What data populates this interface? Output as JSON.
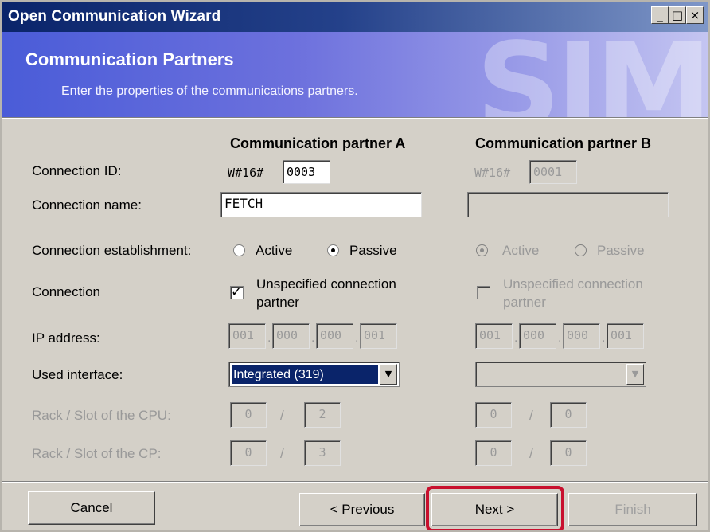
{
  "window": {
    "title": "Open Communication Wizard",
    "controls": {
      "minimize": "_",
      "maximize": "□",
      "close": "×"
    }
  },
  "header": {
    "title": "Communication Partners",
    "subtitle": "Enter the properties of the communications partners.",
    "watermark": "SIM"
  },
  "columns": {
    "a": "Communication partner A",
    "b": "Communication partner B"
  },
  "labels": {
    "connection_id": "Connection ID:",
    "connection_name": "Connection name:",
    "connection_establishment": "Connection establishment:",
    "connection": "Connection",
    "ip_address": "IP address:",
    "used_interface": "Used interface:",
    "rack_slot_cpu": "Rack / Slot of the  CPU:",
    "rack_slot_cp": "Rack / Slot of the CP:",
    "active": "Active",
    "passive": "Passive",
    "unspecified_line1": "Unspecified connection",
    "unspecified_line2": "partner"
  },
  "partner_a": {
    "id_prefix": "W#16#",
    "id_value": "0003",
    "name": "FETCH",
    "establishment": "Passive",
    "unspecified_checked": true,
    "ip": [
      "001",
      "000",
      "000",
      "001"
    ],
    "interface": "Integrated (319)",
    "cpu_rack": "0",
    "cpu_slot": "2",
    "cp_rack": "0",
    "cp_slot": "3"
  },
  "partner_b": {
    "id_prefix": "W#16#",
    "id_value": "0001",
    "name": "",
    "establishment": "Active",
    "unspecified_checked": false,
    "ip": [
      "001",
      "000",
      "000",
      "001"
    ],
    "interface": "",
    "cpu_rack": "0",
    "cpu_slot": "0",
    "cp_rack": "0",
    "cp_slot": "0"
  },
  "buttons": {
    "cancel": "Cancel",
    "previous": "< Previous",
    "next": "Next >",
    "finish": "Finish"
  },
  "icons": {
    "check": "✓",
    "dropdown": "▼"
  },
  "colors": {
    "highlight": "#c8102e",
    "title_bar": "#0a246a",
    "header": "#6d71dd"
  }
}
